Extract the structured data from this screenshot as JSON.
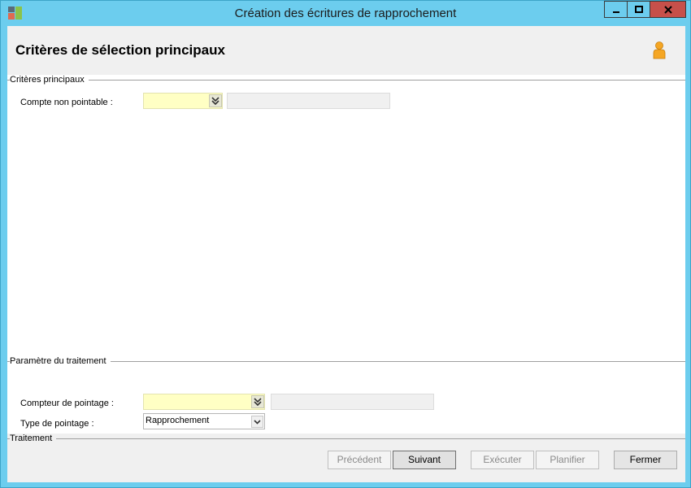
{
  "window": {
    "title": "Création des écritures de rapprochement"
  },
  "header": {
    "title": "Critères de sélection principaux",
    "user_icon": "user-icon"
  },
  "criteria_group": {
    "label": "Critères principaux",
    "fields": {
      "compte_label": "Compte non pointable :",
      "compte_value": "",
      "compte_description": ""
    }
  },
  "params_group": {
    "label": "Paramètre du traitement",
    "fields": {
      "compteur_label": "Compteur de pointage :",
      "compteur_value": "",
      "compteur_description": "",
      "type_label": "Type de pointage :",
      "type_value": "Rapprochement"
    }
  },
  "footer": {
    "group_label": "Traitement",
    "buttons": {
      "previous": "Précédent",
      "next": "Suivant",
      "execute": "Exécuter",
      "schedule": "Planifier",
      "close": "Fermer"
    }
  },
  "colors": {
    "titlebar": "#6ccdee",
    "required_field": "#ffffc4",
    "close_button": "#c7504a"
  }
}
